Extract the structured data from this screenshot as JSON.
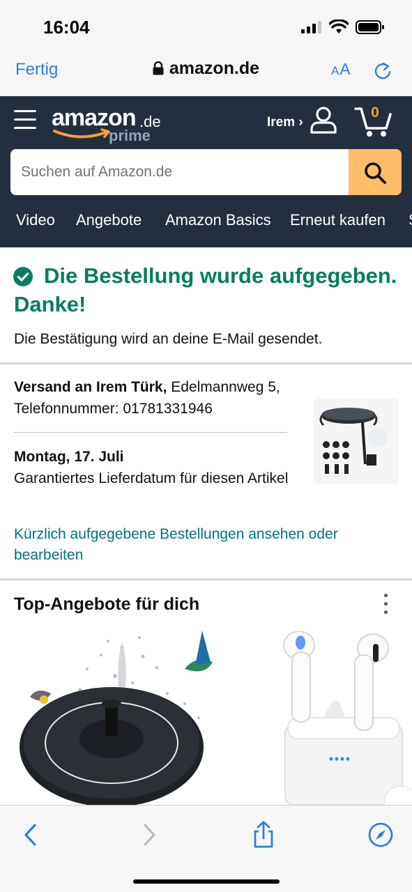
{
  "status_bar": {
    "time": "16:04"
  },
  "browser": {
    "done_label": "Fertig",
    "url": "amazon.de",
    "text_size_label": "AA"
  },
  "amazon_header": {
    "logo_word": "amazon",
    "logo_tld": ".de",
    "logo_prime": "prime",
    "account_name": "Irem ›",
    "cart_count": "0",
    "search_placeholder": "Suchen auf Amazon.de",
    "nav_items": [
      "Video",
      "Angebote",
      "Amazon Basics",
      "Erneut kaufen",
      "S"
    ]
  },
  "confirmation": {
    "title": "Die Bestellung wurde aufgegeben. Danke!",
    "subtitle": "Die Bestätigung wird an deine E-Mail gesendet."
  },
  "shipment": {
    "ship_to_label": "Versand an Irem Türk,",
    "address": "Edelmannweg 5, Telefonnummer: 01781331946",
    "delivery_date": "Montag, 17. Juli",
    "delivery_note": "Garantiertes Lieferdatum für diesen Artikel",
    "orders_link": "Kürzlich aufgegebene Bestellungen ansehen oder bearbeiten"
  },
  "offers": {
    "title": "Top-Angebote für dich"
  },
  "colors": {
    "header_bg": "#232f3e",
    "search_button": "#febd69",
    "success_green": "#067d62",
    "link_teal": "#007185",
    "cart_count": "#f0a33c",
    "safari_blue": "#2f7fd9"
  },
  "icons": [
    "lock-icon",
    "reload-icon",
    "hamburger-icon",
    "account-icon",
    "cart-icon",
    "search-icon",
    "check-icon",
    "more-icon",
    "back-icon",
    "forward-icon",
    "share-icon",
    "compass-icon"
  ]
}
